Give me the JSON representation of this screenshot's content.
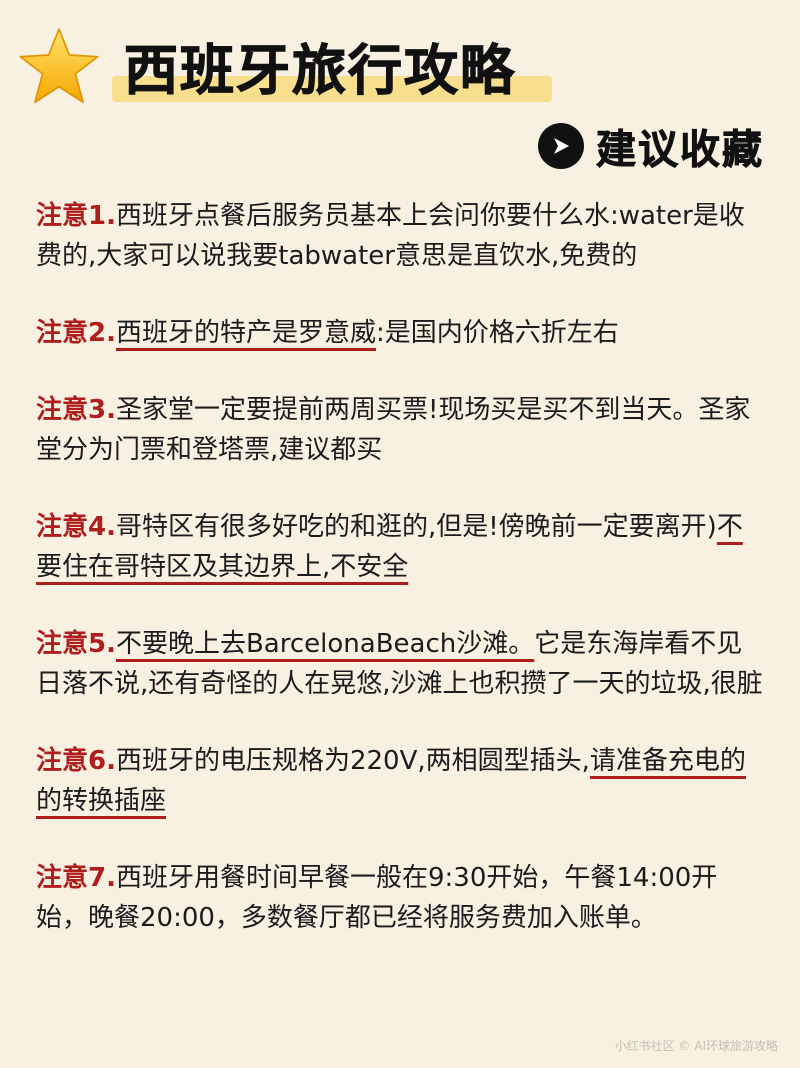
{
  "header": {
    "title": "西班牙旅行攻略",
    "star_icon": "star-icon",
    "highlight_color": "#f6dd84"
  },
  "save": {
    "label": "建议收藏",
    "icon": "arrow-right-icon"
  },
  "colors": {
    "accent": "#b01d1d",
    "background": "#f8f1e2",
    "text": "#1c1c1c"
  },
  "notes": [
    {
      "prefix": "注意1.",
      "segments": [
        {
          "text": "西班牙点餐后服务员基本上会问你要什么水:water是收费的,大家可以说我要tabwater意思是直饮水,免费的",
          "underline": false
        }
      ]
    },
    {
      "prefix": "注意2.",
      "segments": [
        {
          "text": "西班牙的特产是罗意威",
          "underline": true
        },
        {
          "text": ":是国内价格六折左右",
          "underline": false
        }
      ]
    },
    {
      "prefix": "注意3.",
      "segments": [
        {
          "text": "圣家堂一定要提前两周买票!现场买是买不到当天。圣家堂分为门票和登塔票,建议都买",
          "underline": false
        }
      ]
    },
    {
      "prefix": "注意4.",
      "segments": [
        {
          "text": "哥特区有很多好吃的和逛的,但是!傍晚前一定要离开)",
          "underline": false
        },
        {
          "text": "不要住在哥特区及其边界上,不安全",
          "underline": true
        }
      ]
    },
    {
      "prefix": "注意5.",
      "segments": [
        {
          "text": "不要晚上去BarcelonaBeach沙滩。",
          "underline": true
        },
        {
          "text": "它是东海岸看不见日落不说,还有奇怪的人在晃悠,沙滩上也积攒了一天的垃圾,很脏",
          "underline": false
        }
      ]
    },
    {
      "prefix": "注意6.",
      "segments": [
        {
          "text": "西班牙的电压规格为220V,两相圆型插头,",
          "underline": false
        },
        {
          "text": "请准备充电的的转换插座",
          "underline": true
        }
      ]
    },
    {
      "prefix": "注意7.",
      "segments": [
        {
          "text": "西班牙用餐时间早餐一般在9:30开始，午餐14:00开始，晚餐20:00，多数餐厅都已经将服务费加入账单。",
          "underline": false
        }
      ]
    }
  ],
  "watermark": "小红书社区 © AI环球旅游攻略"
}
